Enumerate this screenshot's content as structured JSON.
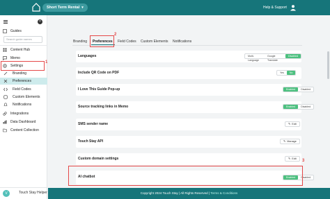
{
  "header": {
    "site_name": "Short Term Rental",
    "help_label": "Help & Support"
  },
  "sidebar": {
    "search_placeholder": "Search guide names",
    "items": [
      {
        "label": "Guides",
        "icon": "book-icon"
      },
      {
        "label": "Content Hub",
        "icon": "grid-icon"
      },
      {
        "label": "Memo",
        "icon": "chat-icon"
      },
      {
        "label": "Settings",
        "icon": "gear-icon"
      },
      {
        "label": "Branding",
        "icon": "brush-icon"
      },
      {
        "label": "Preferences",
        "icon": "sliders-icon"
      },
      {
        "label": "Field Codes",
        "icon": "code-icon"
      },
      {
        "label": "Custom Elements",
        "icon": "puzzle-icon"
      },
      {
        "label": "Notifications",
        "icon": "bell-icon"
      },
      {
        "label": "Integrations",
        "icon": "link-icon"
      },
      {
        "label": "Data Dashboard",
        "icon": "chart-icon"
      },
      {
        "label": "Content Collection",
        "icon": "folder-icon"
      }
    ],
    "helper_label": "Touch Stay Helper",
    "helper_avatar": "V"
  },
  "tabs": [
    {
      "label": "Branding"
    },
    {
      "label": "Preferences"
    },
    {
      "label": "Field Codes"
    },
    {
      "label": "Custom Elements"
    },
    {
      "label": "Notifications"
    }
  ],
  "settings": {
    "languages": {
      "label": "Languages",
      "options": [
        "Multi-Language",
        "Google Translate",
        "Disabled"
      ],
      "selected": "Disabled"
    },
    "qr": {
      "label": "Include QR Code on PDF",
      "options": [
        "Yes",
        "No"
      ],
      "selected": "No"
    },
    "popup": {
      "label": "I Love This Guide Pop-up",
      "options": [
        "Enabled",
        "Disabled"
      ],
      "selected": "Enabled"
    },
    "tracking": {
      "label": "Source tracking links in Memo",
      "options": [
        "Enabled",
        "Disabled"
      ],
      "selected": "Enabled"
    },
    "sms": {
      "label": "SMS sender name",
      "button": "Edit"
    },
    "api": {
      "label": "Touch Stay API",
      "button": "Manage"
    },
    "domain": {
      "label": "Custom domain settings",
      "button": "Edit"
    },
    "chatbot": {
      "label": "AI chatbot",
      "options": [
        "Enabled",
        "Disabled"
      ],
      "selected": "Enabled"
    }
  },
  "annotations": [
    "1",
    "2",
    "3"
  ],
  "footer": {
    "copyright": "Copyright 2024 Touch Stay | All Rights Reserved | ",
    "link": "Terms & Conditions"
  },
  "colors": {
    "brand": "#16757a",
    "active": "#4cc07f",
    "annotation": "#e54848"
  }
}
